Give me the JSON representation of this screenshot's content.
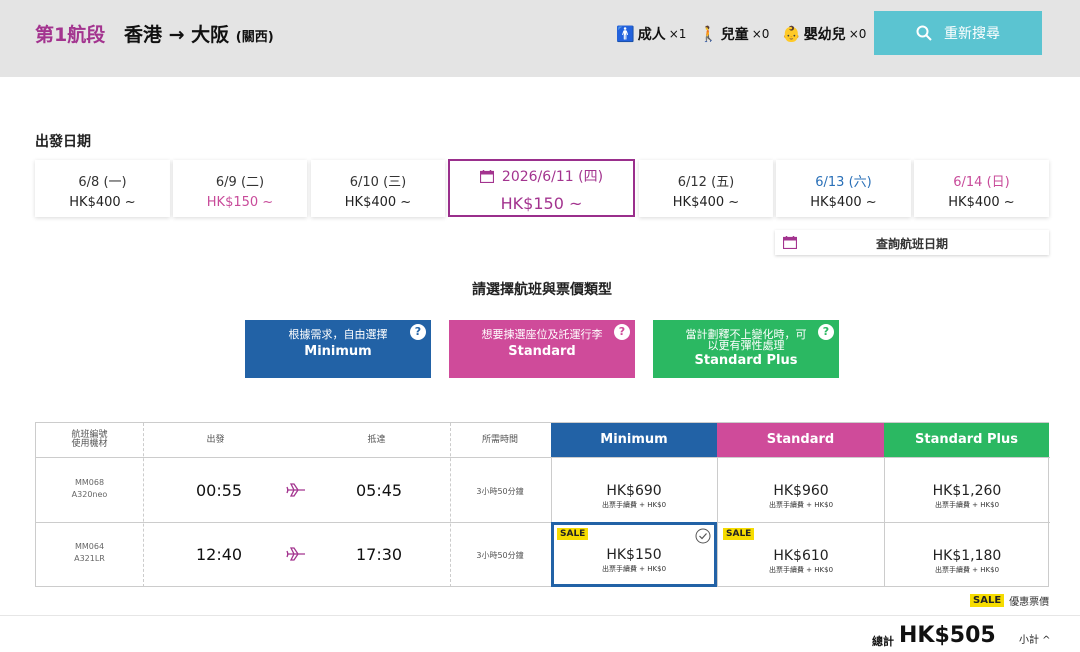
{
  "header": {
    "segment": "第1航段",
    "route": "香港 → 大阪",
    "route_sub": "(關西)",
    "pax": [
      {
        "label": "成人",
        "count": "×1"
      },
      {
        "label": "兒童",
        "count": "×0"
      },
      {
        "label": "嬰幼兒",
        "count": "×0"
      }
    ],
    "search_label": "重新搜尋"
  },
  "dates": {
    "title": "出發日期",
    "cards": [
      {
        "date": "6/8 (一)",
        "price": "HK$400 ~"
      },
      {
        "date": "6/9 (二)",
        "price": "HK$150 ~"
      },
      {
        "date": "6/10 (三)",
        "price": "HK$400 ~"
      },
      {
        "date": "2026/6/11 (四)",
        "price": "HK$150 ~"
      },
      {
        "date": "6/12 (五)",
        "price": "HK$400 ~"
      },
      {
        "date": "6/13 (六)",
        "price": "HK$400 ~"
      },
      {
        "date": "6/14 (日)",
        "price": "HK$400 ~"
      }
    ],
    "lookup_label": "查詢航班日期"
  },
  "fare_section": {
    "title": "請選擇航班與票價類型",
    "types": [
      {
        "desc": "根據需求，自由選擇",
        "name": "Minimum"
      },
      {
        "desc": "想要揀選座位及託運行李",
        "name": "Standard"
      },
      {
        "desc": "當計劃釋不上變化時，可以更有彈性處理",
        "name": "Standard Plus"
      }
    ],
    "help": "?"
  },
  "table": {
    "headers": {
      "flight": "航班編號",
      "aircraft": "使用機材",
      "depart": "出發",
      "arrive": "抵達",
      "duration": "所需時間",
      "minimum": "Minimum",
      "standard": "Standard",
      "plus": "Standard Plus"
    },
    "fee_note": "出票手續費 + HK$0",
    "rows": [
      {
        "flight": "MM068",
        "aircraft": "A320neo",
        "dep": "00:55",
        "arr": "05:45",
        "dur": "3小時50分鐘",
        "min": "HK$690",
        "std": "HK$960",
        "plus": "HK$1,260"
      },
      {
        "flight": "MM064",
        "aircraft": "A321LR",
        "dep": "12:40",
        "arr": "17:30",
        "dur": "3小時50分鐘",
        "min": "HK$150",
        "std": "HK$610",
        "plus": "HK$1,180"
      }
    ],
    "sale": "SALE",
    "sale_legend": "優惠票價"
  },
  "footer": {
    "total_label": "總計",
    "total": "HK$505",
    "subtotal": "小計 ^"
  },
  "colors": {
    "brand_purple": "#a3348f",
    "minimum_blue": "#2262a6",
    "standard_pink": "#cf4b9a",
    "plus_green": "#2bb862",
    "search_cyan": "#5bc4d1",
    "sale_yellow": "#f6dc00"
  }
}
